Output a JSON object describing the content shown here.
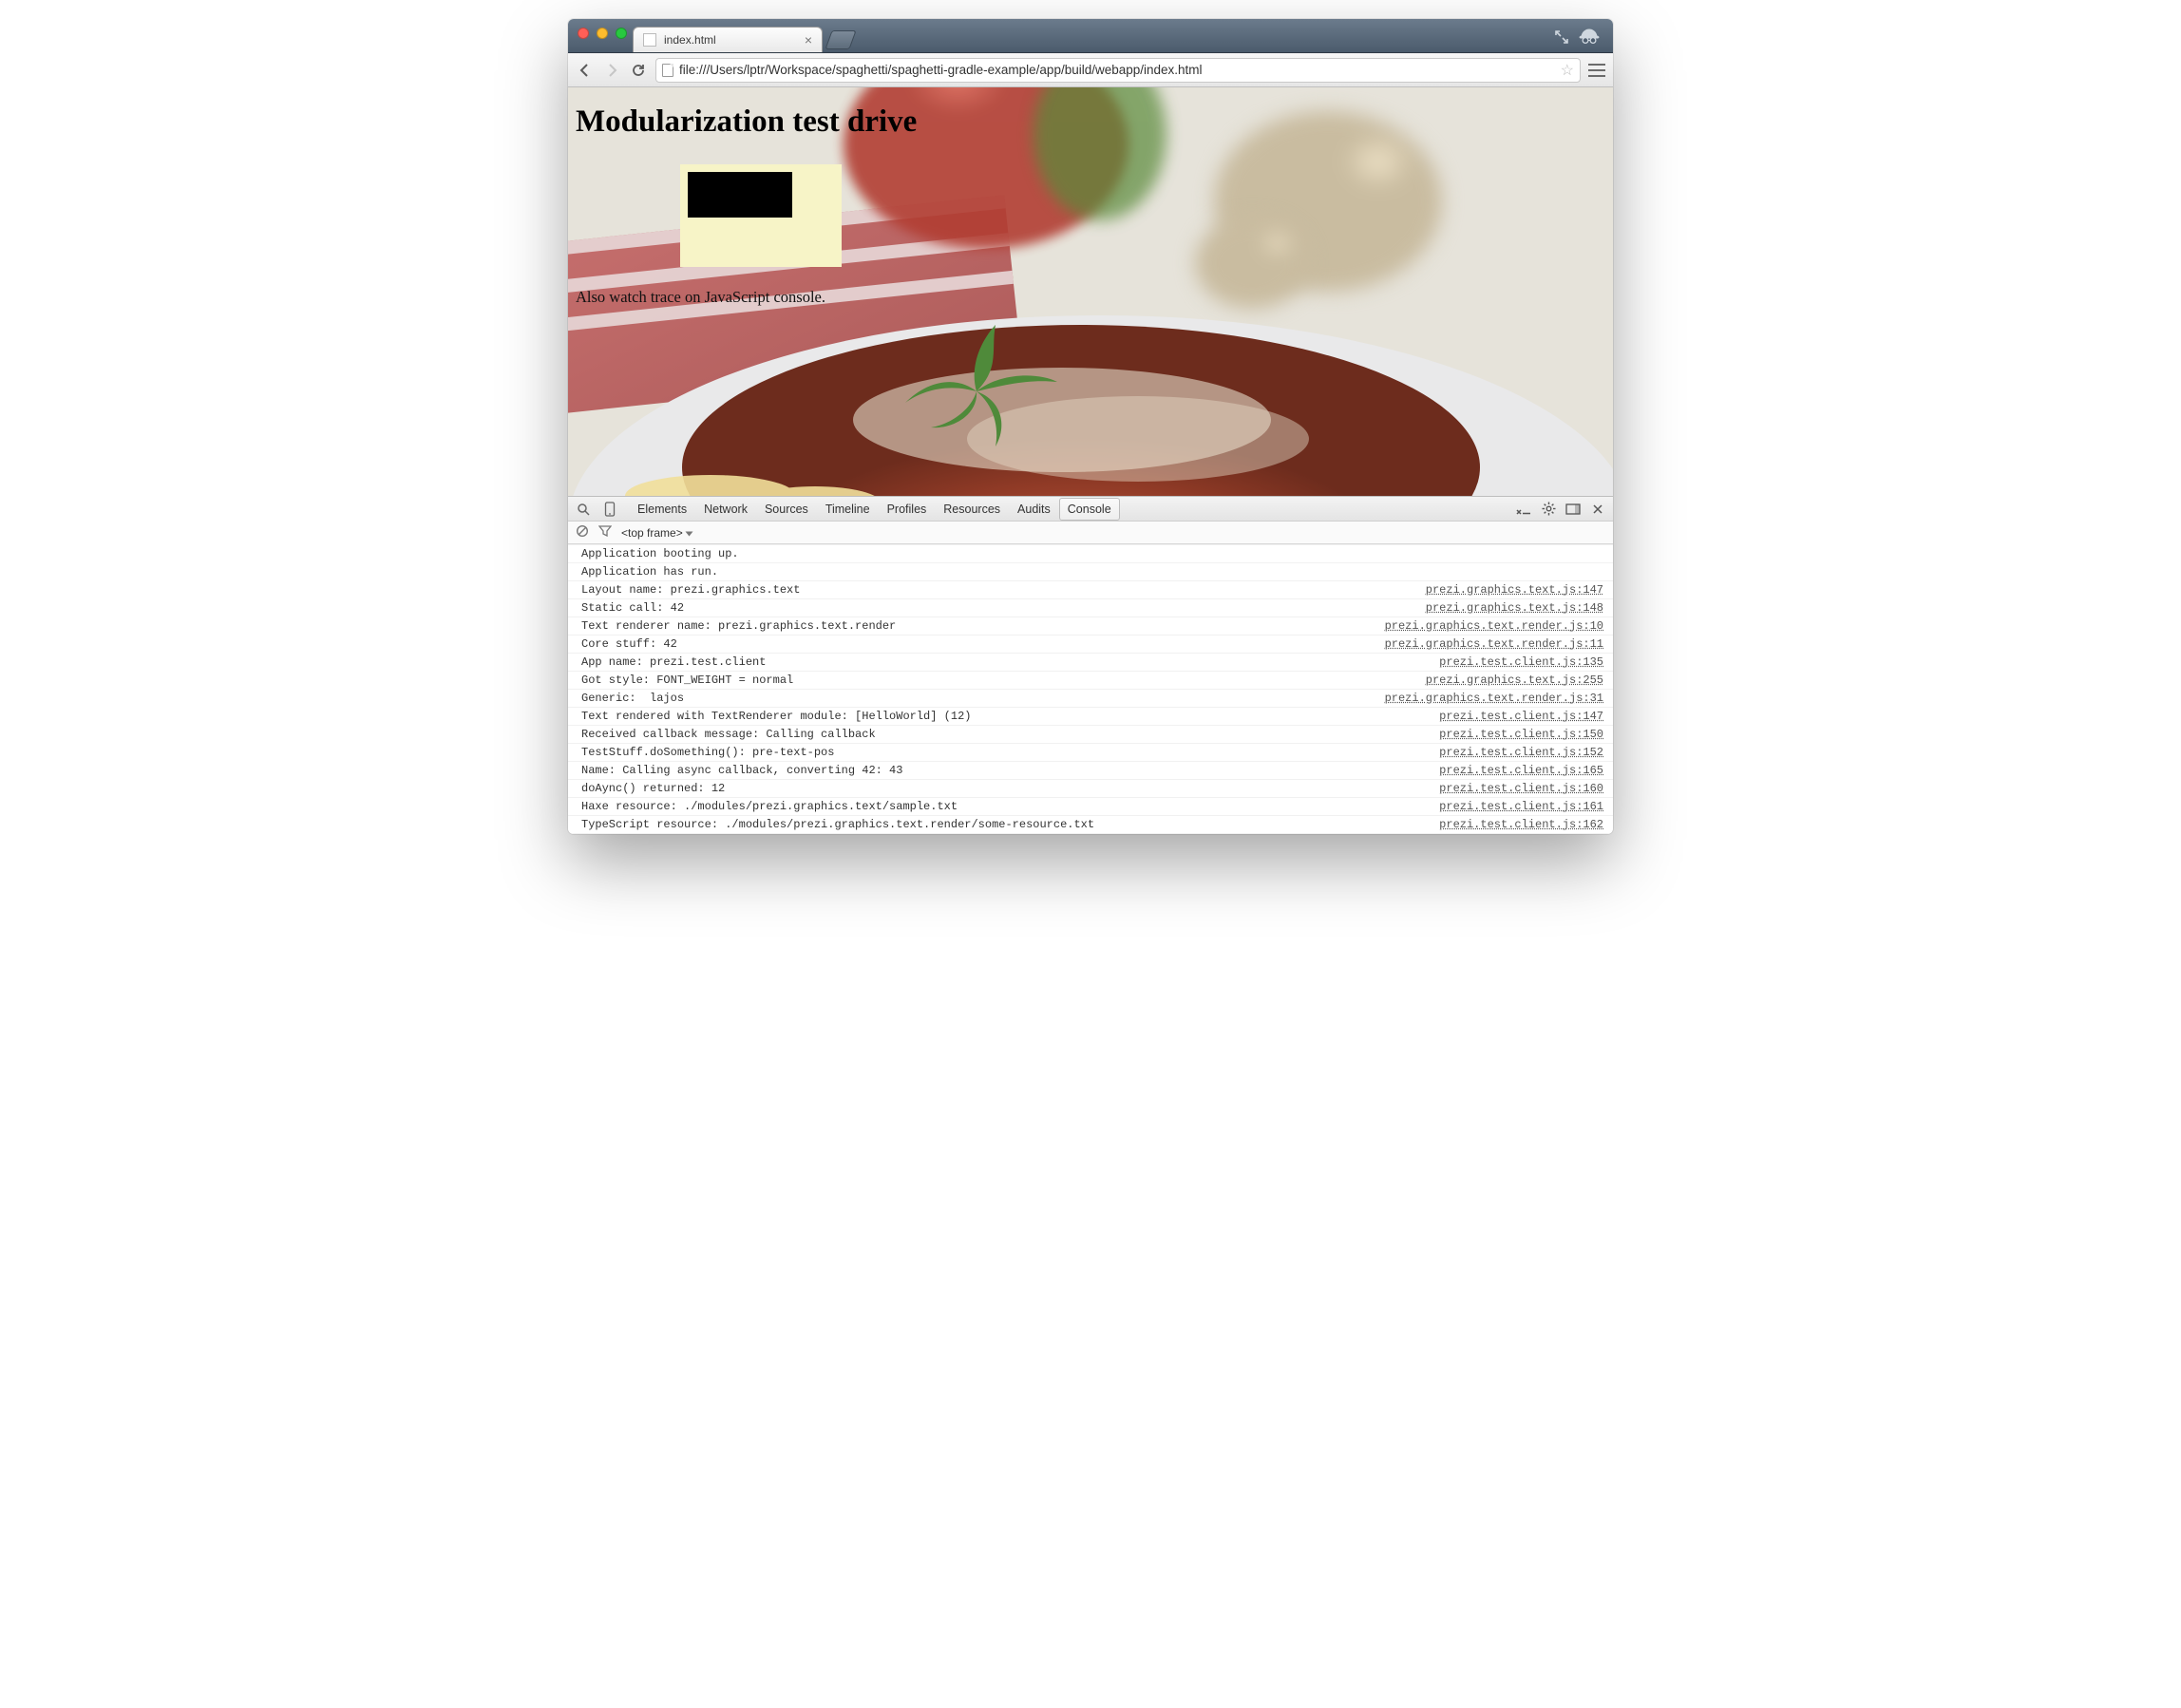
{
  "tab": {
    "title": "index.html"
  },
  "omnibox": {
    "url": "file:///Users/lptr/Workspace/spaghetti/spaghetti-gradle-example/app/build/webapp/index.html"
  },
  "page": {
    "heading": "Modularization test drive",
    "tip": "Also watch trace on JavaScript console."
  },
  "devtools": {
    "tabs": [
      "Elements",
      "Network",
      "Sources",
      "Timeline",
      "Profiles",
      "Resources",
      "Audits",
      "Console"
    ],
    "active_tab": "Console",
    "frame_selector": "<top frame>"
  },
  "console": [
    {
      "msg": "Application booting up.",
      "src": ""
    },
    {
      "msg": "Application has run.",
      "src": ""
    },
    {
      "msg": "Layout name: prezi.graphics.text",
      "src": "prezi.graphics.text.js:147"
    },
    {
      "msg": "Static call: 42",
      "src": "prezi.graphics.text.js:148"
    },
    {
      "msg": "Text renderer name: prezi.graphics.text.render",
      "src": "prezi.graphics.text.render.js:10"
    },
    {
      "msg": "Core stuff: 42",
      "src": "prezi.graphics.text.render.js:11"
    },
    {
      "msg": "App name: prezi.test.client",
      "src": "prezi.test.client.js:135"
    },
    {
      "msg": "Got style: FONT_WEIGHT = normal",
      "src": "prezi.graphics.text.js:255"
    },
    {
      "msg": "Generic:  lajos",
      "src": "prezi.graphics.text.render.js:31"
    },
    {
      "msg": "Text rendered with TextRenderer module: [HelloWorld] (12)",
      "src": "prezi.test.client.js:147"
    },
    {
      "msg": "Received callback message: Calling callback",
      "src": "prezi.test.client.js:150"
    },
    {
      "msg": "TestStuff.doSomething(): pre-text-pos",
      "src": "prezi.test.client.js:152"
    },
    {
      "msg": "Name: Calling async callback, converting 42: 43",
      "src": "prezi.test.client.js:165"
    },
    {
      "msg": "doAync() returned: 12",
      "src": "prezi.test.client.js:160"
    },
    {
      "msg": "Haxe resource: ./modules/prezi.graphics.text/sample.txt",
      "src": "prezi.test.client.js:161"
    },
    {
      "msg": "TypeScript resource: ./modules/prezi.graphics.text.render/some-resource.txt",
      "src": "prezi.test.client.js:162"
    }
  ]
}
